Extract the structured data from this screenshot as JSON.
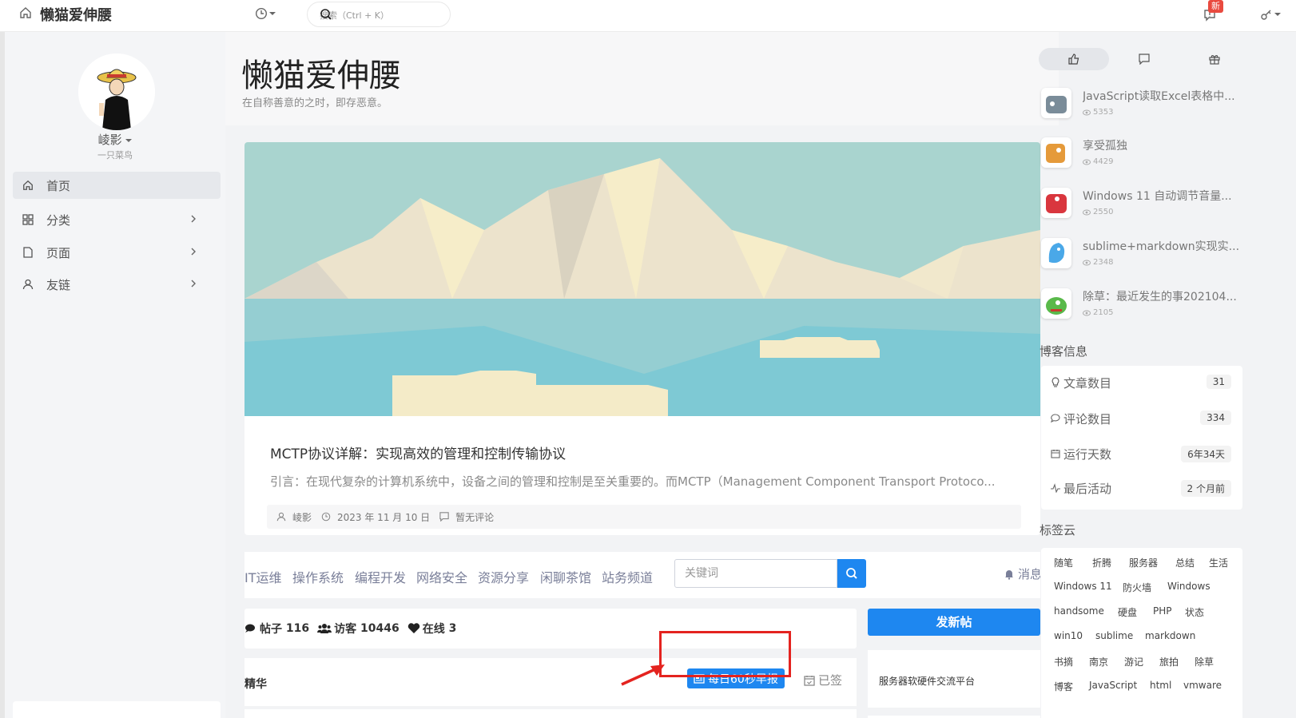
{
  "topbar": {
    "site_name": "懒猫爱伸腰",
    "search_placeholder": "搜索（Ctrl + K）",
    "new_badge": "新"
  },
  "sidebar": {
    "user_name": "崚影",
    "user_sub": "一只菜鸟",
    "items": [
      {
        "label": "首页",
        "icon": "home-icon"
      },
      {
        "label": "分类",
        "icon": "grid-icon"
      },
      {
        "label": "页面",
        "icon": "page-icon"
      },
      {
        "label": "友链",
        "icon": "user-icon"
      }
    ]
  },
  "main": {
    "blog_title": "懒猫爱伸腰",
    "blog_sub": "在自称善意的之时，即存恶意。",
    "post": {
      "title": "MCTP协议详解：实现高效的管理和控制传输协议",
      "excerpt": "引言：在现代复杂的计算机系统中，设备之间的管理和控制是至关重要的。而MCTP（Management Component Transport Protoco...",
      "author": "崚影",
      "date": "2023 年 11 月 10 日",
      "comments": "暂无评论"
    }
  },
  "forum": {
    "nav": [
      "IT运维",
      "操作系统",
      "编程开发",
      "网络安全",
      "资源分享",
      "闲聊茶馆",
      "站务频道"
    ],
    "keyword_placeholder": "关键词",
    "msg_label": "消息",
    "stats": [
      {
        "label": "帖子",
        "value": "116",
        "icon": "chat-icon"
      },
      {
        "label": "访客",
        "value": "10446",
        "icon": "users-icon"
      },
      {
        "label": "在线",
        "value": "3",
        "icon": "heart-icon"
      }
    ],
    "post_button": "发新帖",
    "section_label": "精华",
    "daily_button": "每日60秒早报",
    "signed_label": "已签",
    "platform": "服务器软硬件交流平台"
  },
  "right": {
    "tabs": [
      "thumbs-up-icon",
      "comment-icon",
      "gift-icon"
    ],
    "hot_posts": [
      {
        "title": "JavaScript读取Excel表格中...",
        "views": "5353",
        "color": "#7a8c99"
      },
      {
        "title": "享受孤独",
        "views": "4429",
        "color": "#e59a3a"
      },
      {
        "title": "Windows 11 自动调节音量...",
        "views": "2550",
        "color": "#d9363e"
      },
      {
        "title": "sublime+markdown实现实...",
        "views": "2348",
        "color": "#4aa8e8"
      },
      {
        "title": "除草：最近发生的事202104...",
        "views": "2105",
        "color": "#59b94a"
      }
    ],
    "info_title": "博客信息",
    "info": [
      {
        "label": "文章数目",
        "value": "31",
        "icon": "bulb-icon"
      },
      {
        "label": "评论数目",
        "value": "334",
        "icon": "comment-icon"
      },
      {
        "label": "运行天数",
        "value": "6年34天",
        "icon": "calendar-icon"
      },
      {
        "label": "最后活动",
        "value": "2 个月前",
        "icon": "pulse-icon"
      }
    ],
    "tags_title": "标签云",
    "tags": [
      "随笔",
      "折腾",
      "服务器",
      "总结",
      "生活",
      "Windows 11",
      "防火墙",
      "Windows",
      "handsome",
      "硬盘",
      "PHP",
      "状态",
      "win10",
      "sublime",
      "markdown",
      "书摘",
      "南京",
      "游记",
      "旅拍",
      "除草",
      "博客",
      "JavaScript",
      "html",
      "vmware"
    ]
  },
  "colors": {
    "accent": "#1e87f0",
    "highlight": "#e4231f"
  }
}
